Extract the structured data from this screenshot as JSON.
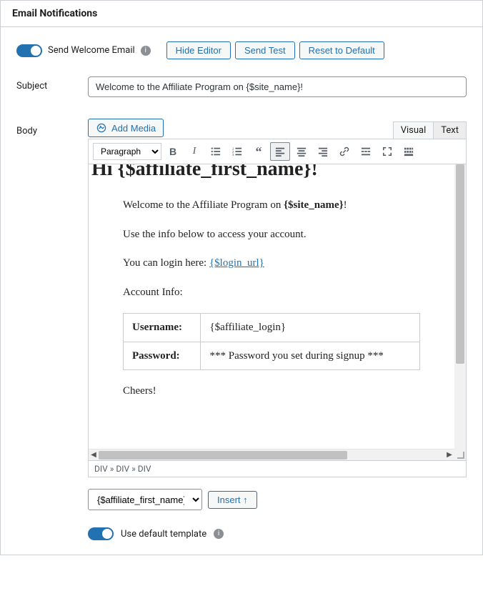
{
  "panel": {
    "title": "Email Notifications"
  },
  "toggle": {
    "welcome_label": "Send Welcome Email",
    "use_default_template_label": "Use default template"
  },
  "buttons": {
    "hide_editor": "Hide Editor",
    "send_test": "Send Test",
    "reset_default": "Reset to Default",
    "add_media": "Add Media",
    "insert": "Insert ↑"
  },
  "fields": {
    "subject_label": "Subject",
    "subject_value": "Welcome to the Affiliate Program on {$site_name}!",
    "body_label": "Body"
  },
  "editor": {
    "tabs": {
      "visual": "Visual",
      "text": "Text"
    },
    "format_select": "Paragraph",
    "status_path": "DIV » DIV » DIV",
    "var_select": "{$affiliate_first_name}",
    "content": {
      "heading": "Hi {$affiliate_first_name}!",
      "p1_pre": "Welcome to the Affiliate Program on ",
      "p1_bold": "{$site_name}",
      "p1_post": "!",
      "p2": "Use the info below to access your account.",
      "p3_pre": "You can login here: ",
      "p3_link": "{$login_url}",
      "p4": "Account Info:",
      "table": {
        "username_label": "Username:",
        "username_value": "{$affiliate_login}",
        "password_label": "Password:",
        "password_value": "*** Password you set during signup ***"
      },
      "p5": "Cheers!"
    }
  },
  "icons": {
    "info": "i"
  }
}
